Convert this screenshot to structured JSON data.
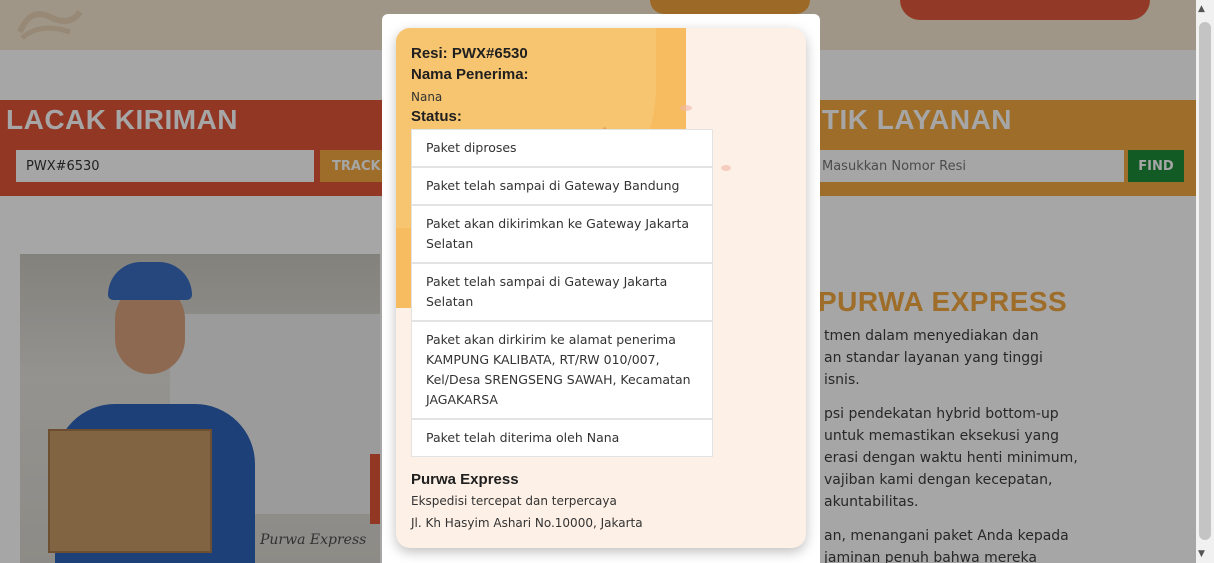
{
  "track_section": {
    "title": "LACAK KIRIMAN",
    "input_value": "PWX#6530",
    "button_label": "TRACK"
  },
  "service_section": {
    "title": "TITIK LAYANAN",
    "input_placeholder": "Masukkan Nomor Resi",
    "button_label": "FIND"
  },
  "photo": {
    "brand_text": "Purwa Express"
  },
  "about": {
    "title": "PURWA EXPRESS",
    "lines": [
      "tmen dalam menyediakan dan",
      "an standar layanan yang tinggi",
      "isnis.",
      "psi pendekatan hybrid bottom-up",
      " untuk memastikan eksekusi yang",
      "erasi dengan waktu henti minimum,",
      "vajiban kami dengan kecepatan,",
      "akuntabilitas.",
      "an, menangani paket Anda kepada",
      "jaminan penuh bahwa mereka"
    ]
  },
  "modal": {
    "resi_label": "Resi: PWX#6530",
    "recipient_label": "Nama Penerima:",
    "recipient_name": "Nana",
    "status_label": "Status:",
    "statuses": [
      "Paket diproses",
      "Paket telah sampai di Gateway Bandung",
      "Paket akan dikirimkan ke Gateway Jakarta Selatan",
      "Paket telah sampai di Gateway Jakarta Selatan",
      "Paket akan dirkirim ke alamat penerima KAMPUNG KALIBATA, RT/RW 010/007, Kel/Desa SRENGSENG SAWAH, Kecamatan JAGAKARSA",
      "Paket telah diterima oleh Nana"
    ],
    "company_name": "Purwa Express",
    "company_tagline": "Ekspedisi tercepat dan terpercaya",
    "company_address": "Jl. Kh Hasyim Ashari No.10000, Jakarta"
  },
  "colors": {
    "track_band": "#e2553a",
    "service_band": "#f2a83f",
    "find_button": "#1e8c3a",
    "card_background": "#fdf0e6",
    "card_accent": "#f7bb60"
  }
}
